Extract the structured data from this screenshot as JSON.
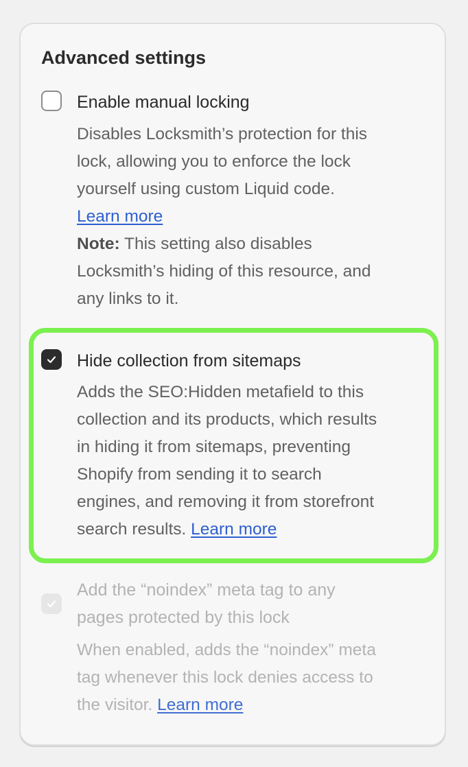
{
  "section": {
    "title": "Advanced settings"
  },
  "options": [
    {
      "label": "Enable manual locking",
      "checked": false,
      "disabled": false,
      "description_lines": [
        "Disables Locksmith’s protection for this",
        "lock, allowing you to enforce the lock",
        "yourself using custom Liquid code."
      ],
      "link": "Learn more",
      "note_label": "Note:",
      "note_lines": [
        " This setting also disables",
        "Locksmith’s hiding of this resource, and",
        "any links to it."
      ]
    },
    {
      "label": "Hide collection from sitemaps",
      "checked": true,
      "disabled": false,
      "highlighted": true,
      "description_lines": [
        "Adds the SEO:Hidden metafield to this",
        "collection and its products, which results",
        "in hiding it from sitemaps, preventing",
        "Shopify from sending it to search",
        "engines, and removing it from storefront",
        "search results. "
      ],
      "link": "Learn more"
    },
    {
      "label_lines": [
        "Add the “noindex” meta tag to any",
        "pages protected by this lock"
      ],
      "checked": true,
      "disabled": true,
      "description_lines": [
        "When enabled, adds the “noindex” meta",
        "tag whenever this lock denies access to",
        "the visitor. "
      ],
      "link": "Learn more"
    }
  ],
  "colors": {
    "highlight": "#7bf04f",
    "link": "#2d5fd0",
    "checkbox_checked": "#2c2c2c"
  },
  "icons": {
    "checkmark": "check-icon"
  }
}
